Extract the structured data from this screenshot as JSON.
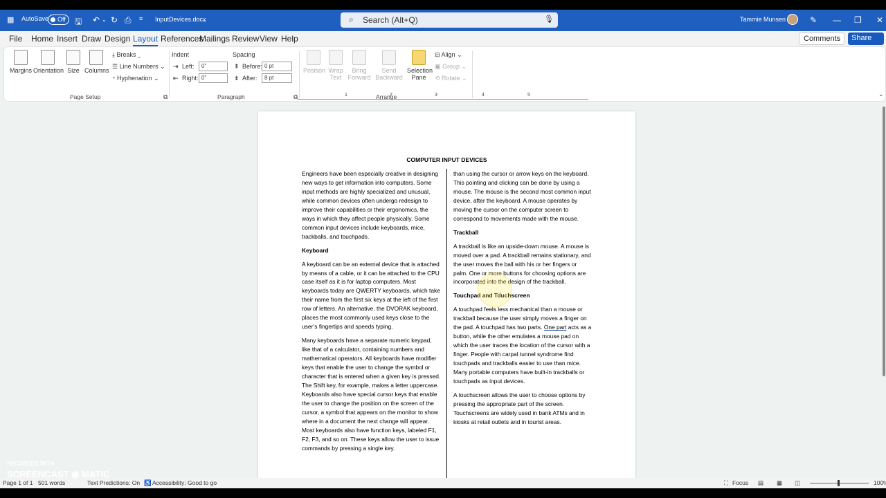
{
  "titlebar": {
    "autosave_label": "AutoSave",
    "autosave_state": "Off",
    "document_name": "InputDevices.docx",
    "search_placeholder": "Search (Alt+Q)",
    "user_name": "Tammie Munsen",
    "bg_color": "#1f5fbf"
  },
  "menu": {
    "tabs": [
      "File",
      "Home",
      "Insert",
      "Draw",
      "Design",
      "Layout",
      "References",
      "Mailings",
      "Review",
      "View",
      "Help"
    ],
    "active_tab": "Layout",
    "comments_label": "Comments",
    "share_label": "Share"
  },
  "ribbon": {
    "page_setup": {
      "group_label": "Page Setup",
      "margins": "Margins",
      "orientation": "Orientation",
      "size": "Size",
      "columns": "Columns",
      "breaks": "Breaks",
      "line_numbers": "Line Numbers",
      "hyphenation": "Hyphenation"
    },
    "paragraph": {
      "group_label": "Paragraph",
      "indent_label": "Indent",
      "left_label": "Left:",
      "left_value": "0\"",
      "right_label": "Right:",
      "right_value": "0\"",
      "spacing_label": "Spacing",
      "before_label": "Before:",
      "before_value": "0 pt",
      "after_label": "After:",
      "after_value": "8 pt"
    },
    "arrange": {
      "group_label": "Arrange",
      "position": "Position",
      "wrap_text": "Wrap Text",
      "bring_forward": "Bring Forward",
      "send_backward": "Send Backward",
      "selection_pane": "Selection Pane",
      "align": "Align",
      "group": "Group",
      "rotate": "Rotate"
    }
  },
  "ruler": {
    "ticks": [
      "1",
      "2",
      "3",
      "4",
      "5"
    ]
  },
  "document": {
    "title": "COMPUTER INPUT DEVICES",
    "col1": {
      "p1": "Engineers have been especially creative in designing new ways to get information into computers. Some input methods are highly specialized and unusual, while common devices often undergo redesign to improve their capabilities or their ergonomics, the ways in which they affect people physically. Some common input devices include keyboards, mice, trackballs, and touchpads.",
      "h_keyboard": "Keyboard",
      "p2": "A keyboard can be an external device that is attached by means of a cable, or it can be attached to the CPU case itself as it is for laptop computers. Most keyboards today are QWERTY keyboards, which take their name from the first six keys at the left of the first row of letters. An alternative, the DVORAK keyboard, places the most commonly used keys close to the user’s fingertips and speeds typing.",
      "p3": "Many keyboards have a separate numeric keypad, like that of a calculator, containing numbers and mathematical operators. All keyboards have modifier keys that enable the user to change the symbol or character that is entered when a given key is pressed. The Shift key, for example, makes a letter uppercase. Keyboards also have special cursor keys that enable the user to change the position on the screen of the cursor, a symbol that appears on the monitor to show where in a document the next change will appear. Most keyboards also have function keys, labeled F1, F2, F3, and so on. These keys allow the user to issue commands by pressing a single key."
    },
    "col2": {
      "p1": "than using the cursor or arrow keys on the keyboard. This pointing and clicking can be done by using a mouse. The mouse is the second most common input device, after the keyboard. A mouse operates by moving the cursor on the computer screen to correspond to movements made with the mouse.",
      "h_trackball": "Trackball",
      "p2": "A trackball is like an upside-down mouse. A mouse is moved over a pad. A trackball remains stationary, and the user moves the ball with his or her fingers or palm. One or more buttons for choosing options are incorporated into the design of the trackball.",
      "h_touchpad": "Touchpad and Touchscreen",
      "p3_a": "A touchpad feels less mechanical than a mouse or trackball because the user simply moves a finger on the pad. A touchpad has two parts. ",
      "p3_b": "One part",
      "p3_c": " acts as a button, while the other emulates a mouse pad on which the user traces the location of the cursor with a finger. People with carpal tunnel syndrome find touchpads and trackballs easier to use than mice. Many portable computers have built-in trackballs or touchpads as input devices.",
      "p4": "A touchscreen allows the user to choose options by pressing the appropriate part of the screen. Touchscreens are widely used in bank ATMs and in kiosks at retail outlets and in tourist areas."
    }
  },
  "statusbar": {
    "page": "Page 1 of 1",
    "words": "501 words",
    "text_predictions": "Text Predictions: On",
    "accessibility": "Accessibility: Good to go",
    "focus": "Focus",
    "zoom": "100%"
  },
  "watermark": {
    "line1": "RECORDED WITH",
    "line2": "SCREENCAST ◉ MATIC"
  }
}
